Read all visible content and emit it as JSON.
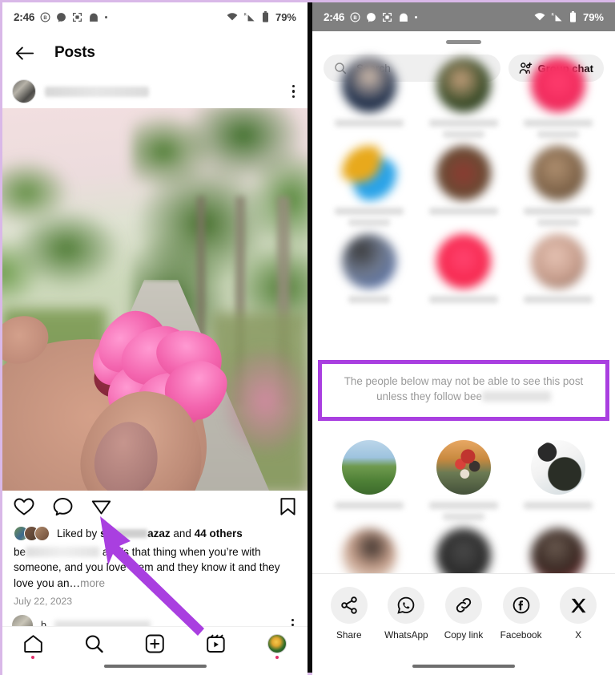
{
  "status_bar": {
    "time": "2:46",
    "battery_percent": "79%",
    "icons": [
      "beeper-badge-icon",
      "messenger-icon",
      "screenshot-icon",
      "home-app-icon",
      "dot-icon",
      "wifi-icon",
      "signal-roaming-icon",
      "battery-icon"
    ]
  },
  "left_phone": {
    "header": {
      "back_icon": "back-arrow-icon",
      "title": "Posts",
      "more_icon": "three-dots-icon"
    },
    "post": {
      "username_redacted": "",
      "actions": [
        "heart-icon",
        "comment-icon",
        "share-paper-plane-icon",
        "bookmark-icon"
      ],
      "liked_by_prefix": "Liked by",
      "liked_by_name": "sa",
      "liked_by_name_tail": "azaz",
      "liked_by_middle": "and",
      "liked_by_count": "44 others",
      "caption_prefix": "be",
      "caption_mid": "a",
      "caption_text": "“It’s that thing when you’re with someone, and you love them and they know it and they love you an…",
      "caption_more": "more",
      "date": "July 22, 2023",
      "comment_prefix": "b"
    },
    "bottom_nav": [
      "home-icon",
      "search-icon",
      "create-plus-icon",
      "reels-icon",
      "profile-avatar"
    ]
  },
  "right_phone": {
    "sheet": {
      "grabber": "drag-handle",
      "search_placeholder": "Search",
      "group_chat_label": "Group chat",
      "notice_text_line1": "The people below may not be able to see this post unless",
      "notice_text_line2_prefix": "they follow bee",
      "notice_text_line2_redacted": ""
    },
    "share_bar": [
      {
        "label": "Share",
        "icon": "share-nodes-icon"
      },
      {
        "label": "WhatsApp",
        "icon": "whatsapp-icon"
      },
      {
        "label": "Copy link",
        "icon": "link-icon"
      },
      {
        "label": "Facebook",
        "icon": "facebook-icon"
      },
      {
        "label": "X",
        "icon": "x-twitter-icon"
      }
    ]
  },
  "annotations": {
    "highlight_box_color": "#a93fe0",
    "arrow_color": "#a93fe0",
    "arrow_points_to": "share-paper-plane-icon"
  },
  "colors": {
    "accent_purple": "#a93fe0",
    "outer_border": "#d9b8e8",
    "status_bar_dark": "#808080",
    "chip_gray": "#efefef",
    "muted_text": "#8e8e8e"
  }
}
